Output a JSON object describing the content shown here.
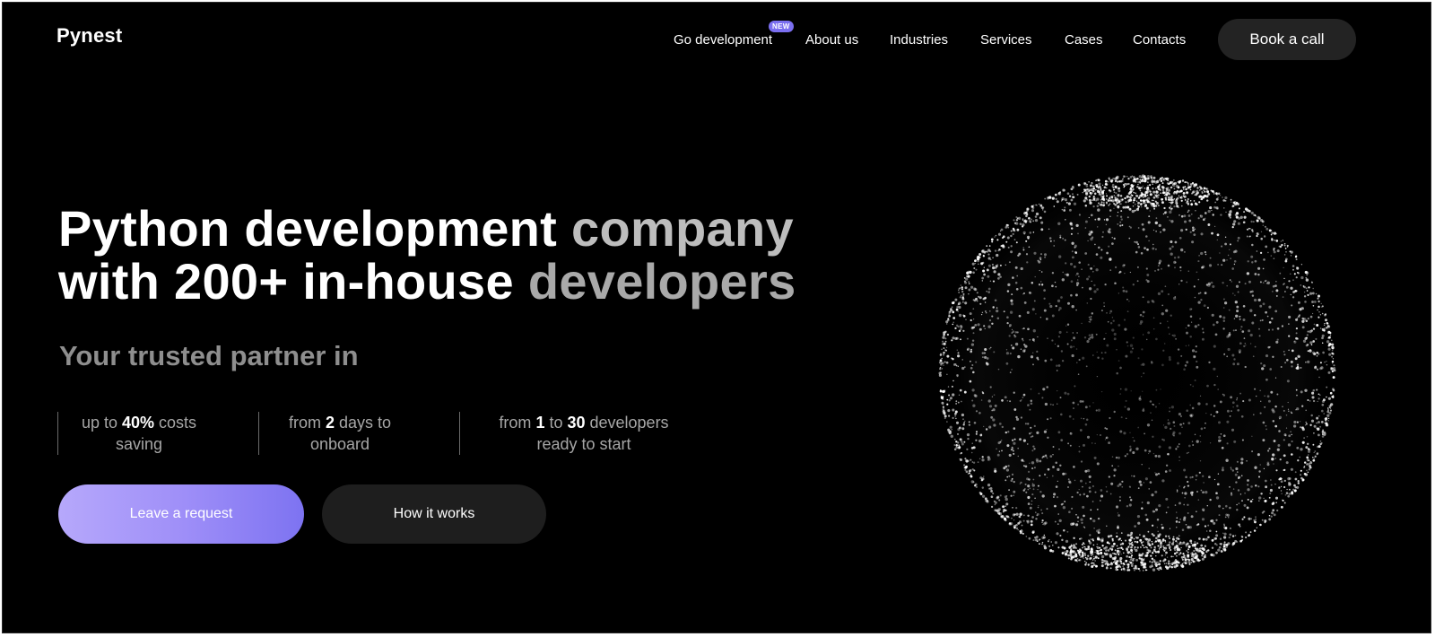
{
  "header": {
    "logo": "Pynest",
    "nav": [
      {
        "label": "Go development",
        "badge": "NEW"
      },
      {
        "label": "About us"
      },
      {
        "label": "Industries"
      },
      {
        "label": "Services"
      },
      {
        "label": "Cases"
      },
      {
        "label": "Contacts"
      }
    ],
    "cta": "Book a call"
  },
  "hero": {
    "line1_white": "Python development ",
    "line1_gray": "company",
    "line2_white": "with 200+ in-house ",
    "line2_gray": "developers",
    "subtitle": "Your trusted partner in",
    "stats": [
      {
        "a": "up to ",
        "b": "40%",
        "c": " costs",
        "line2": "saving"
      },
      {
        "a": "from ",
        "b": "2",
        "c": " days to",
        "line2": "onboard"
      },
      {
        "a": "from ",
        "b": "1",
        "c": " to ",
        "d": "30",
        "e": " developers",
        "line2": "ready to start"
      }
    ],
    "primary_button": "Leave a request",
    "secondary_button": "How it works"
  },
  "colors": {
    "background": "#000000",
    "accent_gradient_start": "#b6a8fb",
    "accent_gradient_end": "#7d73f1",
    "badge": "#7b6ff0"
  },
  "icons": {
    "hero_visual": "particle-sphere"
  }
}
